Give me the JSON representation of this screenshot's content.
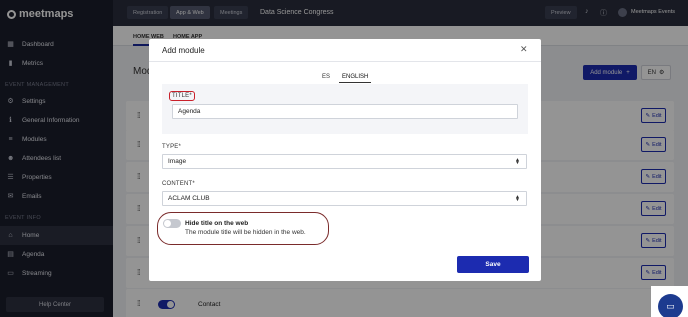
{
  "brand": {
    "name": "meetmaps"
  },
  "sidebar": {
    "items_top": [
      {
        "label": "Dashboard",
        "icon": "dashboard-icon",
        "glyph": "▦"
      },
      {
        "label": "Metrics",
        "icon": "metrics-icon",
        "glyph": "▮"
      }
    ],
    "section_management": "EVENT MANAGEMENT",
    "items_mgmt": [
      {
        "label": "Settings",
        "icon": "settings-icon",
        "glyph": "⚙"
      },
      {
        "label": "General Information",
        "icon": "info-icon",
        "glyph": "ℹ"
      },
      {
        "label": "Modules",
        "icon": "modules-icon",
        "glyph": "≡"
      },
      {
        "label": "Attendees list",
        "icon": "attendees-icon",
        "glyph": "☻"
      },
      {
        "label": "Properties",
        "icon": "properties-icon",
        "glyph": "☰"
      },
      {
        "label": "Emails",
        "icon": "email-icon",
        "glyph": "✉"
      }
    ],
    "section_info": "EVENT INFO",
    "items_info": [
      {
        "label": "Home",
        "icon": "home-icon",
        "glyph": "⌂"
      },
      {
        "label": "Agenda",
        "icon": "agenda-icon",
        "glyph": "▤"
      },
      {
        "label": "Streaming",
        "icon": "streaming-icon",
        "glyph": "▭"
      }
    ],
    "help": "Help Center"
  },
  "topbar": {
    "tabs": [
      "Registration",
      "App & Web",
      "Meetings"
    ],
    "active_tab": "App & Web",
    "event_name": "Data Science Congress",
    "preview": "Preview",
    "account": "Meetmaps Events"
  },
  "main": {
    "subtabs": [
      "HOME WEB",
      "HOME APP"
    ],
    "title": "Modules",
    "add_module": "Add module",
    "lang": "EN",
    "edit_label": "Edit",
    "last_row_label": "Contact"
  },
  "modal": {
    "title": "Add module",
    "langs": [
      "ES",
      "ENGLISH"
    ],
    "active_lang": "ENGLISH",
    "title_label": "TITLE*",
    "title_value": "Agenda",
    "type_label": "TYPE*",
    "type_value": "Image",
    "content_label": "CONTENT*",
    "content_value": "ACLAM CLUB",
    "hide_title": "Hide title on the web",
    "hide_desc": "The module title will be hidden in the web.",
    "hide_enabled": false,
    "save": "Save"
  },
  "colors": {
    "primary": "#1c2bb0",
    "sidebar": "#1b1e2b",
    "highlight": "#c9202a"
  }
}
